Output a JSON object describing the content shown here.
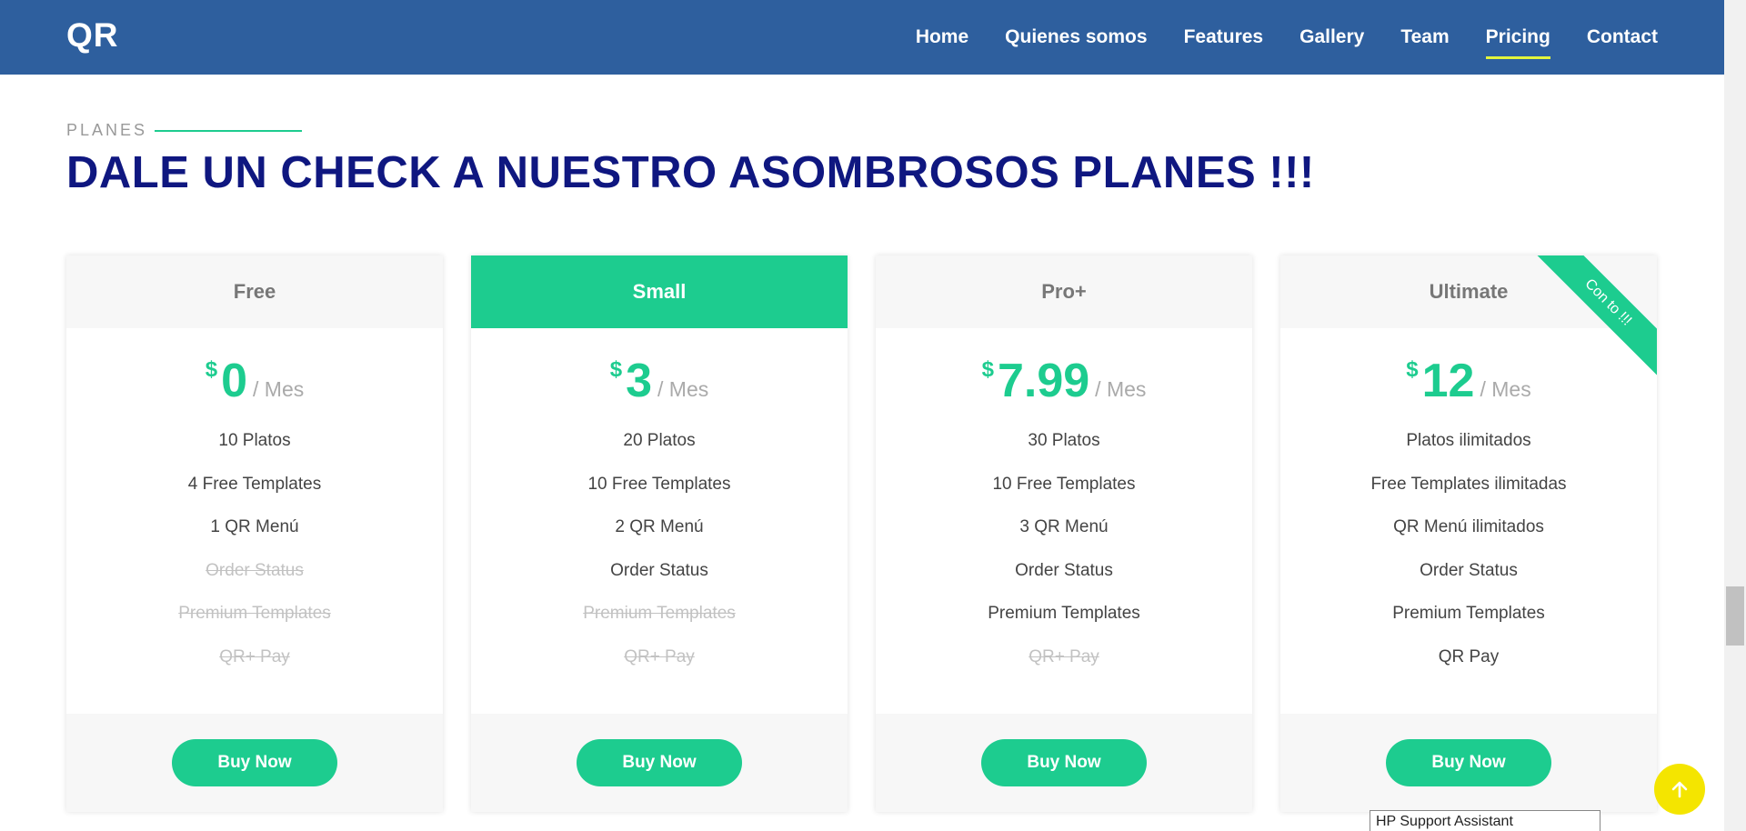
{
  "header": {
    "logo": "QR",
    "nav": [
      "Home",
      "Quienes somos",
      "Features",
      "Gallery",
      "Team",
      "Pricing",
      "Contact"
    ],
    "active": "Pricing"
  },
  "section": {
    "label": "PLANES",
    "title": "DALE UN CHECK A NUESTRO ASOMBROSOS PLANES !!!"
  },
  "plans": [
    {
      "name": "Free",
      "currency": "$",
      "price": "0",
      "period": "/ Mes",
      "featured": false,
      "features": [
        {
          "text": "10 Platos",
          "included": true
        },
        {
          "text": "4 Free Templates",
          "included": true
        },
        {
          "text": "1 QR Menú",
          "included": true
        },
        {
          "text": "Order Status",
          "included": false
        },
        {
          "text": "Premium Templates",
          "included": false
        },
        {
          "text": "QR+ Pay",
          "included": false
        }
      ],
      "button": "Buy Now"
    },
    {
      "name": "Small",
      "currency": "$",
      "price": "3",
      "period": "/ Mes",
      "featured": true,
      "features": [
        {
          "text": "20 Platos",
          "included": true
        },
        {
          "text": "10 Free Templates",
          "included": true
        },
        {
          "text": "2 QR Menú",
          "included": true
        },
        {
          "text": "Order Status",
          "included": true
        },
        {
          "text": "Premium Templates",
          "included": false
        },
        {
          "text": "QR+ Pay",
          "included": false
        }
      ],
      "button": "Buy Now"
    },
    {
      "name": "Pro+",
      "currency": "$",
      "price": "7.99",
      "period": "/ Mes",
      "featured": false,
      "features": [
        {
          "text": "30 Platos",
          "included": true
        },
        {
          "text": "10 Free Templates",
          "included": true
        },
        {
          "text": "3 QR Menú",
          "included": true
        },
        {
          "text": "Order Status",
          "included": true
        },
        {
          "text": "Premium Templates",
          "included": true
        },
        {
          "text": "QR+ Pay",
          "included": false
        }
      ],
      "button": "Buy Now"
    },
    {
      "name": "Ultimate",
      "currency": "$",
      "price": "12",
      "period": "/ Mes",
      "featured": false,
      "ribbon": "Con to !!!",
      "features": [
        {
          "text": "Platos ilimitados",
          "included": true
        },
        {
          "text": "Free Templates ilimitadas",
          "included": true
        },
        {
          "text": "QR Menú ilimitados",
          "included": true
        },
        {
          "text": "Order Status",
          "included": true
        },
        {
          "text": "Premium Templates",
          "included": true
        },
        {
          "text": "QR Pay",
          "included": true
        }
      ],
      "button": "Buy Now"
    }
  ],
  "tooltip": "HP Support Assistant",
  "icons": {
    "back_to_top": "arrow-up-icon"
  },
  "colors": {
    "header_bg": "#2e5f9e",
    "accent": "#1dcc8f",
    "title": "#0f1780",
    "nav_underline": "#e3f53c",
    "back_to_top": "#f4e500"
  }
}
